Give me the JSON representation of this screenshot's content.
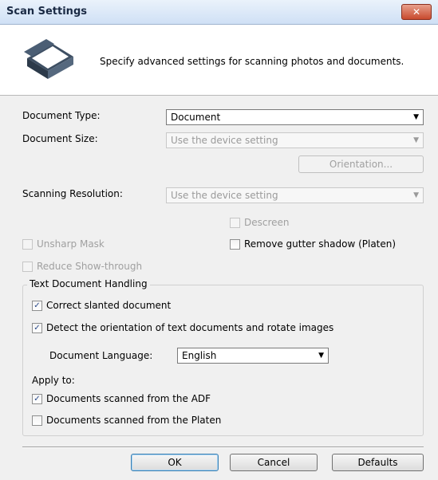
{
  "window": {
    "title": "Scan Settings",
    "close_glyph": "✕"
  },
  "header": {
    "description": "Specify advanced settings for scanning photos and documents.",
    "icon": "scanner-icon"
  },
  "document_type": {
    "label": "Document Type:",
    "value": "Document"
  },
  "document_size": {
    "label": "Document Size:",
    "value": "Use the device setting"
  },
  "orientation_button": "Orientation...",
  "scanning_resolution": {
    "label": "Scanning Resolution:",
    "value": "Use the device setting"
  },
  "descreen": {
    "label": "Descreen",
    "checked": false,
    "enabled": false
  },
  "unsharp_mask": {
    "label": "Unsharp Mask",
    "checked": false,
    "enabled": false
  },
  "remove_gutter_shadow": {
    "label": "Remove gutter shadow (Platen)",
    "checked": false,
    "enabled": true
  },
  "reduce_show_through": {
    "label": "Reduce Show-through",
    "checked": false,
    "enabled": false
  },
  "text_document_handling": {
    "title": "Text Document Handling",
    "correct_slanted": {
      "label": "Correct slanted document",
      "checked": true
    },
    "detect_orientation": {
      "label": "Detect the orientation of text documents and rotate images",
      "checked": true
    },
    "document_language": {
      "label": "Document Language:",
      "value": "English"
    },
    "apply_to_label": "Apply to:",
    "from_adf": {
      "label": "Documents scanned from the ADF",
      "checked": true
    },
    "from_platen": {
      "label": "Documents scanned from the Platen",
      "checked": false
    }
  },
  "buttons": {
    "ok": "OK",
    "cancel": "Cancel",
    "defaults": "Defaults"
  },
  "check_glyph": "✓",
  "arrow_glyph": "▼"
}
